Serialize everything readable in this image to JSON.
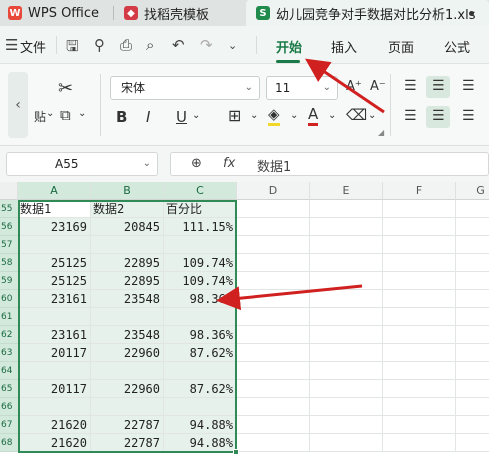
{
  "tabs": [
    {
      "label": "WPS Office",
      "icon": "wps-logo-icon"
    },
    {
      "label": "找稻壳模板",
      "icon": "docer-icon"
    },
    {
      "label": "幼儿园竞争对手数据对比分析1.xls",
      "icon": "sheet-file-icon"
    }
  ],
  "menu": {
    "file_label": "文件",
    "items": [
      "开始",
      "插入",
      "页面",
      "公式"
    ],
    "active": "开始"
  },
  "ribbon": {
    "font_name": "宋体",
    "font_size": "11",
    "paste_label": "贴",
    "bold": "B",
    "italic": "I",
    "underline": "U",
    "font_color": "A"
  },
  "formula_bar": {
    "cell_ref": "A55",
    "fx": "fx",
    "content": "数据1"
  },
  "grid": {
    "columns": [
      "A",
      "B",
      "C",
      "D",
      "E",
      "F",
      "G"
    ],
    "row_numbers": [
      "55",
      "56",
      "57",
      "58",
      "59",
      "60",
      "61",
      "62",
      "63",
      "64",
      "65",
      "66",
      "67",
      "68"
    ],
    "rows": [
      {
        "a": "数据1",
        "b": "数据2",
        "c": "百分比"
      },
      {
        "a": "23169",
        "b": "20845",
        "c": "111.15%"
      },
      {
        "a": "",
        "b": "",
        "c": ""
      },
      {
        "a": "25125",
        "b": "22895",
        "c": "109.74%"
      },
      {
        "a": "25125",
        "b": "22895",
        "c": "109.74%"
      },
      {
        "a": "23161",
        "b": "23548",
        "c": "98.36%"
      },
      {
        "a": "",
        "b": "",
        "c": ""
      },
      {
        "a": "23161",
        "b": "23548",
        "c": "98.36%"
      },
      {
        "a": "20117",
        "b": "22960",
        "c": "87.62%"
      },
      {
        "a": "",
        "b": "",
        "c": ""
      },
      {
        "a": "20117",
        "b": "22960",
        "c": "87.62%"
      },
      {
        "a": "",
        "b": "",
        "c": ""
      },
      {
        "a": "21620",
        "b": "22787",
        "c": "94.88%"
      },
      {
        "a": "21620",
        "b": "22787",
        "c": "94.88%"
      }
    ]
  },
  "colors": {
    "accent_green": "#1a7a48",
    "selection_border": "#2f8a55",
    "annotation_arrow": "#d02020"
  }
}
